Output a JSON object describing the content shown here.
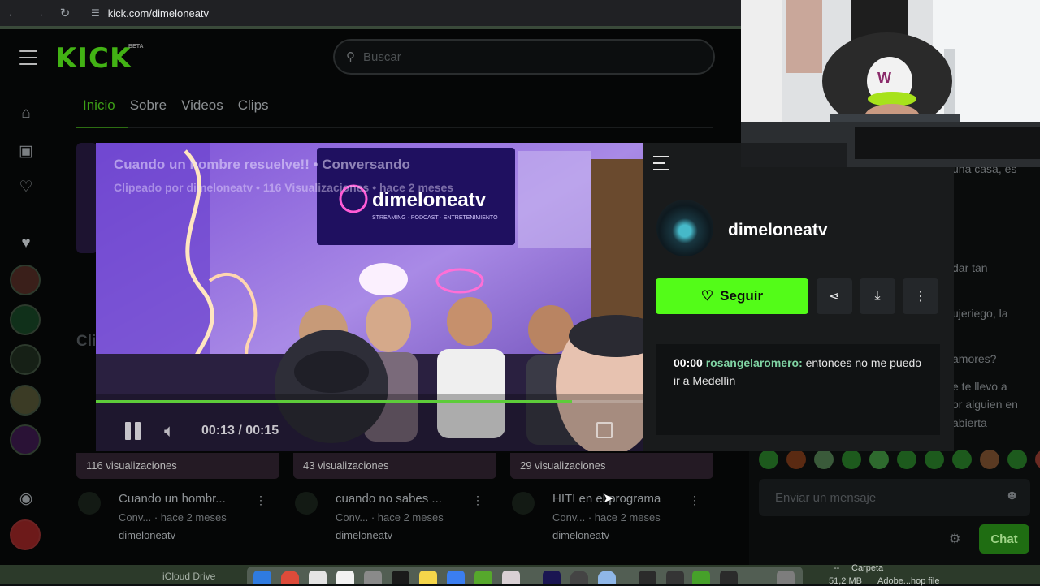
{
  "browser": {
    "url": "kick.com/dimeloneatv"
  },
  "kick": {
    "logo": "KICK",
    "beta": "BETA",
    "search_placeholder": "Buscar",
    "tabs": [
      "Inicio",
      "Sobre",
      "Videos",
      "Clips"
    ],
    "active_tab": "Inicio",
    "bg_section_heading": "Cli"
  },
  "clip": {
    "title": "Cuando un hombre resuelve!! • Conversando",
    "subtitle": "Clipeado por dimeloneatv • 116 Visualizaciones • hace 2 meses",
    "time": "00:13 / 00:15",
    "progress": 0.87
  },
  "panel": {
    "channel_name": "dimeloneatv",
    "follow_label": "Seguir",
    "chat_time": "00:00",
    "chat_user": "rosangelaromero:",
    "chat_message": "entonces no me puedo ir a Medellín"
  },
  "videos": [
    {
      "views": "116 visualizaciones",
      "title": "Cuando un hombr...",
      "sub": "Conv...",
      "age": "· hace 2 meses",
      "channel": "dimeloneatv"
    },
    {
      "views": "43 visualizaciones",
      "title": "cuando no sabes ...",
      "sub": "Conv...",
      "age": "· hace 2 meses",
      "channel": "dimeloneatv"
    },
    {
      "views": "29 visualizaciones",
      "title": "HITI en el programa",
      "sub": "Conv...",
      "age": "· hace 2 meses",
      "channel": "dimeloneatv"
    }
  ],
  "chat": {
    "lines": [
      "una casa, es",
      "dar tan",
      "ujeriego, la",
      "amores?",
      "e te llevo a",
      "or alguien en",
      "abierta"
    ],
    "input_placeholder": "Enviar un mensaje",
    "chat_button": "Chat"
  },
  "dock": {
    "icloud": "iCloud Drive",
    "right_top": "Carpeta",
    "right_bottom_size": "51,2 MB",
    "right_bottom_name": "Adobe...hop file",
    "dash": "--"
  },
  "colors": {
    "brand_green": "#53fc18",
    "panel_bg": "#191b1c",
    "chat_user": "#7fd3a3"
  }
}
